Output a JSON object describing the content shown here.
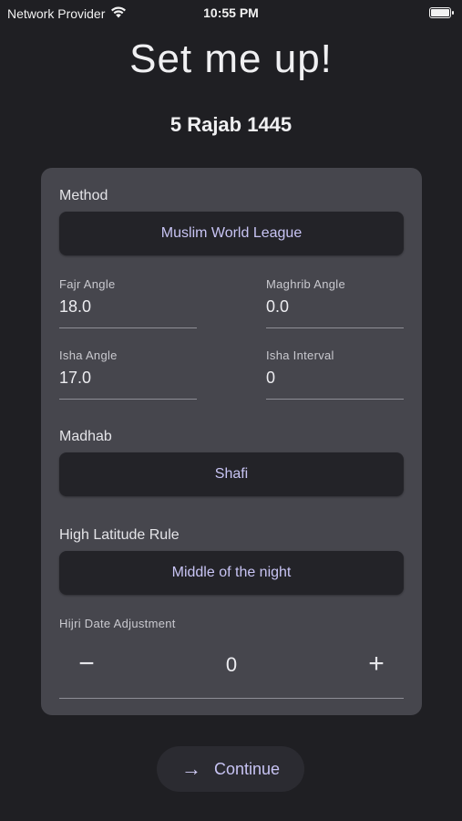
{
  "status_bar": {
    "carrier": "Network Provider",
    "time": "10:55 PM",
    "battery_level": 1.0
  },
  "header": {
    "title": "Set me up!",
    "hijri_date": "5 Rajab 1445"
  },
  "settings": {
    "method": {
      "label": "Method",
      "value": "Muslim World League"
    },
    "fajr_angle": {
      "label": "Fajr Angle",
      "value": "18.0"
    },
    "maghrib_angle": {
      "label": "Maghrib Angle",
      "value": "0.0"
    },
    "isha_angle": {
      "label": "Isha Angle",
      "value": "17.0"
    },
    "isha_interval": {
      "label": "Isha Interval",
      "value": "0"
    },
    "madhab": {
      "label": "Madhab",
      "value": "Shafi"
    },
    "high_latitude_rule": {
      "label": "High Latitude Rule",
      "value": "Middle of the night"
    },
    "hijri_adjustment": {
      "label": "Hijri Date Adjustment",
      "value": "0",
      "minus": "−",
      "plus": "+"
    }
  },
  "actions": {
    "continue_label": "Continue",
    "continue_icon": "→"
  },
  "colors": {
    "background": "#1f1f23",
    "card": "#46464d",
    "selector": "#232328",
    "accent_text": "#c8c4f4"
  },
  "icons": [
    "wifi-icon",
    "battery-icon",
    "minus-icon",
    "plus-icon",
    "arrow-right-icon"
  ]
}
